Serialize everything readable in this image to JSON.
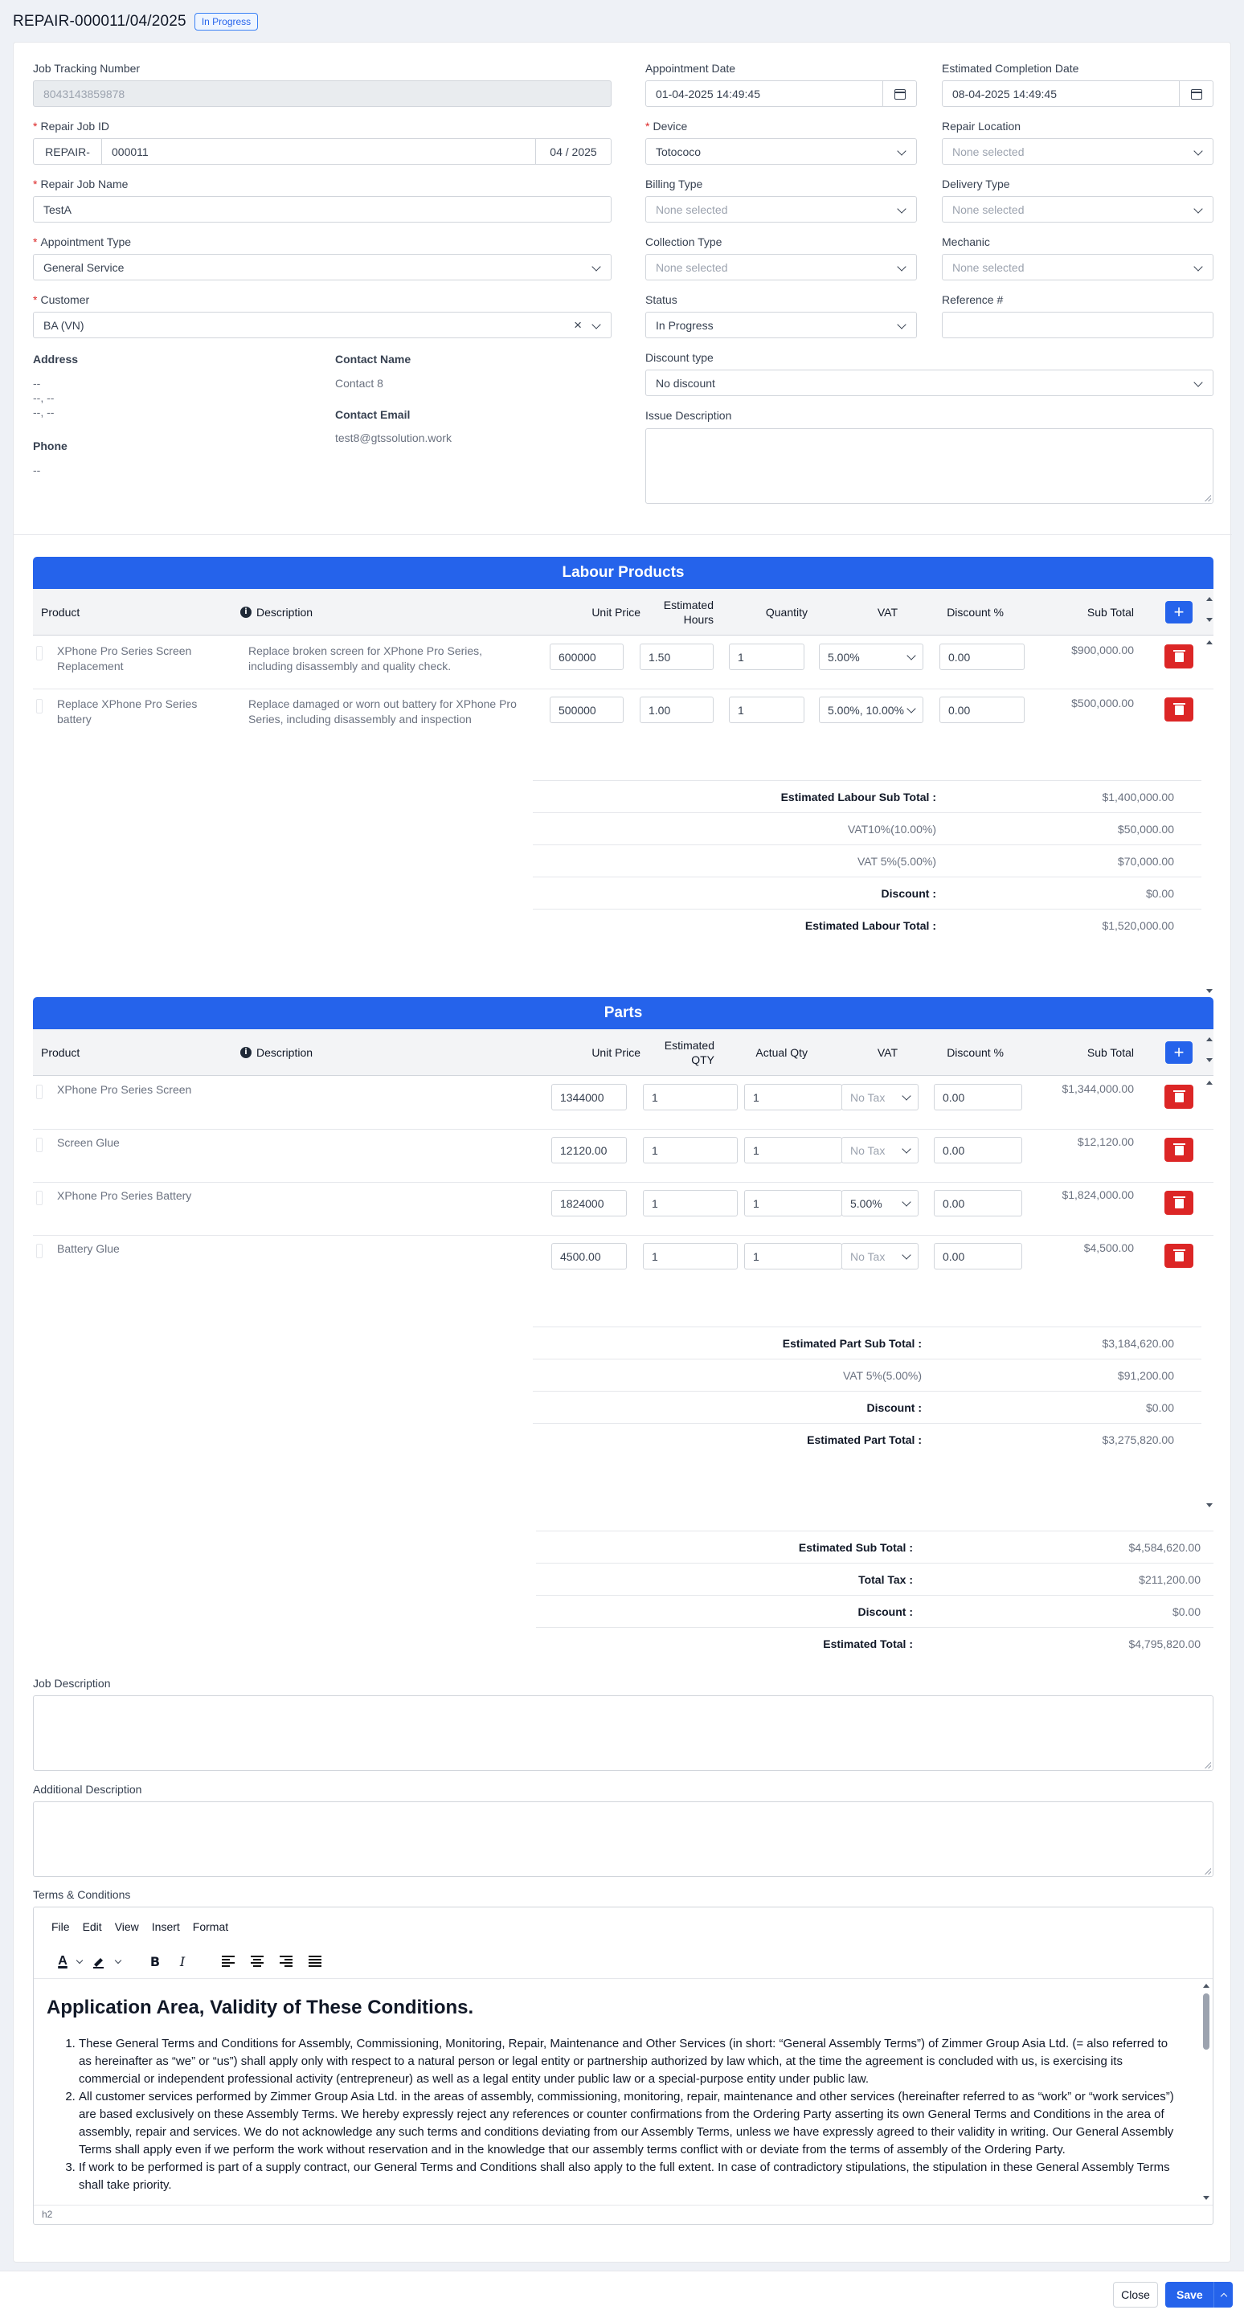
{
  "header": {
    "title": "REPAIR-000011/04/2025",
    "status_badge": "In Progress"
  },
  "form": {
    "job_tracking_number": {
      "label": "Job Tracking Number",
      "value": "8043143859878"
    },
    "repair_job_id": {
      "label": "Repair Job ID",
      "prefix": "REPAIR-",
      "number": "000011",
      "suffix": "04 / 2025"
    },
    "repair_job_name": {
      "label": "Repair Job Name",
      "value": "TestA"
    },
    "appointment_type": {
      "label": "Appointment Type",
      "value": "General Service"
    },
    "customer": {
      "label": "Customer",
      "value": "BA (VN)",
      "clear": "×"
    },
    "address": {
      "label": "Address",
      "lines": [
        "--",
        "--, --",
        "--, --"
      ]
    },
    "contact_name": {
      "label": "Contact Name",
      "value": "Contact 8"
    },
    "contact_email": {
      "label": "Contact Email",
      "value": "test8@gtssolution.work"
    },
    "phone": {
      "label": "Phone",
      "value": "--"
    },
    "appointment_date": {
      "label": "Appointment Date",
      "value": "01-04-2025 14:49:45"
    },
    "estimated_completion_date": {
      "label": "Estimated Completion Date",
      "value": "08-04-2025 14:49:45"
    },
    "device": {
      "label": "Device",
      "value": "Totococo"
    },
    "repair_location": {
      "label": "Repair Location",
      "placeholder": "None selected"
    },
    "billing_type": {
      "label": "Billing Type",
      "placeholder": "None selected"
    },
    "delivery_type": {
      "label": "Delivery Type",
      "placeholder": "None selected"
    },
    "collection_type": {
      "label": "Collection Type",
      "placeholder": "None selected"
    },
    "mechanic": {
      "label": "Mechanic",
      "placeholder": "None selected"
    },
    "status": {
      "label": "Status",
      "value": "In Progress"
    },
    "reference": {
      "label": "Reference #",
      "value": ""
    },
    "discount_type": {
      "label": "Discount type",
      "value": "No discount"
    },
    "issue_description": {
      "label": "Issue Description"
    },
    "required_mark": "*"
  },
  "labour": {
    "title": "Labour Products",
    "columns": [
      "Product",
      "Description",
      "Unit Price",
      "Estimated Hours",
      "Quantity",
      "VAT",
      "Discount %",
      "Sub Total"
    ],
    "info_icon": "i",
    "add_label": "+",
    "rows": [
      {
        "product": "XPhone Pro Series Screen Replacement",
        "description": "Replace broken screen for XPhone Pro Series, including disassembly and quality check.",
        "unit_price": "600000",
        "hours": "1.50",
        "quantity": "1",
        "vat": "5.00%",
        "discount": "0.00",
        "subtotal": "$900,000.00"
      },
      {
        "product": "Replace XPhone Pro Series battery",
        "description": "Replace damaged or worn out battery for XPhone Pro Series, including disassembly and inspection",
        "unit_price": "500000",
        "hours": "1.00",
        "quantity": "1",
        "vat": "5.00%, 10.00%",
        "discount": "0.00",
        "subtotal": "$500,000.00"
      }
    ],
    "summary": [
      {
        "label": "Estimated Labour Sub Total :",
        "value": "$1,400,000.00",
        "bold": true
      },
      {
        "label": "VAT10%(10.00%)",
        "value": "$50,000.00",
        "bold": false
      },
      {
        "label": "VAT 5%(5.00%)",
        "value": "$70,000.00",
        "bold": false
      },
      {
        "label": "Discount :",
        "value": "$0.00",
        "bold": true
      },
      {
        "label": "Estimated Labour Total :",
        "value": "$1,520,000.00",
        "bold": true
      }
    ]
  },
  "parts": {
    "title": "Parts",
    "columns": [
      "Product",
      "Description",
      "Unit Price",
      "Estimated QTY",
      "Actual Qty",
      "VAT",
      "Discount %",
      "Sub Total"
    ],
    "info_icon": "i",
    "add_label": "+",
    "rows": [
      {
        "product": "XPhone Pro Series Screen",
        "unit_price": "1344000",
        "est_qty": "1",
        "actual_qty": "1",
        "vat": "No Tax",
        "vat_placeholder": true,
        "discount": "0.00",
        "subtotal": "$1,344,000.00"
      },
      {
        "product": "Screen Glue",
        "unit_price": "12120.00",
        "est_qty": "1",
        "actual_qty": "1",
        "vat": "No Tax",
        "vat_placeholder": true,
        "discount": "0.00",
        "subtotal": "$12,120.00"
      },
      {
        "product": "XPhone Pro Series Battery",
        "unit_price": "1824000",
        "est_qty": "1",
        "actual_qty": "1",
        "vat": "5.00%",
        "vat_placeholder": false,
        "discount": "0.00",
        "subtotal": "$1,824,000.00"
      },
      {
        "product": "Battery Glue",
        "unit_price": "4500.00",
        "est_qty": "1",
        "actual_qty": "1",
        "vat": "No Tax",
        "vat_placeholder": true,
        "discount": "0.00",
        "subtotal": "$4,500.00"
      }
    ],
    "summary": [
      {
        "label": "Estimated Part Sub Total :",
        "value": "$3,184,620.00",
        "bold": true
      },
      {
        "label": "VAT 5%(5.00%)",
        "value": "$91,200.00",
        "bold": false
      },
      {
        "label": "Discount :",
        "value": "$0.00",
        "bold": true
      },
      {
        "label": "Estimated Part Total :",
        "value": "$3,275,820.00",
        "bold": true
      }
    ]
  },
  "totals": [
    {
      "label": "Estimated Sub Total :",
      "value": "$4,584,620.00"
    },
    {
      "label": "Total Tax :",
      "value": "$211,200.00"
    },
    {
      "label": "Discount :",
      "value": "$0.00"
    },
    {
      "label": "Estimated Total :",
      "value": "$4,795,820.00"
    }
  ],
  "job_description": {
    "label": "Job Description"
  },
  "additional_description": {
    "label": "Additional Description"
  },
  "terms": {
    "label": "Terms & Conditions",
    "menu": [
      "File",
      "Edit",
      "View",
      "Insert",
      "Format"
    ],
    "toolbar": {
      "text_color": "A",
      "bold": "B",
      "italic": "I"
    },
    "heading": "Application Area, Validity of These Conditions.",
    "items": [
      "These General Terms and Conditions for Assembly, Commissioning, Monitoring, Repair, Maintenance and Other Services (in short: “General Assembly Terms”) of Zimmer Group Asia Ltd. (= also referred to as hereinafter as “we” or “us”) shall apply only with respect to a natural person or legal entity or partnership authorized by law which, at the time the agreement is concluded with us, is exercising its commercial or independent professional activity (entrepreneur) as well as a legal entity under public law or a special-purpose entity under public law.",
      "All customer services performed by Zimmer Group Asia Ltd. in the areas of assembly, commissioning, monitoring, repair, maintenance and other services (hereinafter referred to as “work” or “work services”) are based exclusively on these Assembly Terms. We hereby expressly reject any references or counter confirmations from the Ordering Party asserting its own General Terms and Conditions in the area of assembly, repair and services. We do not acknowledge any such terms and conditions deviating from our Assembly Terms, unless we have expressly agreed to their validity in writing. Our General Assembly Terms shall apply even if we perform the work without reservation and in the knowledge that our assembly terms conflict with or deviate from the terms of assembly of the Ordering Party.",
      "If work to be performed is part of a supply contract, our General Terms and Conditions shall also apply to the full extent. In case of contradictory stipulations, the stipulation in these General Assembly Terms shall take priority."
    ],
    "status_path": "h2"
  },
  "footer": {
    "close_label": "Close",
    "save_label": "Save"
  },
  "colors": {
    "primary": "#2563eb",
    "danger": "#dc2626",
    "badge": "#3b82f6"
  }
}
